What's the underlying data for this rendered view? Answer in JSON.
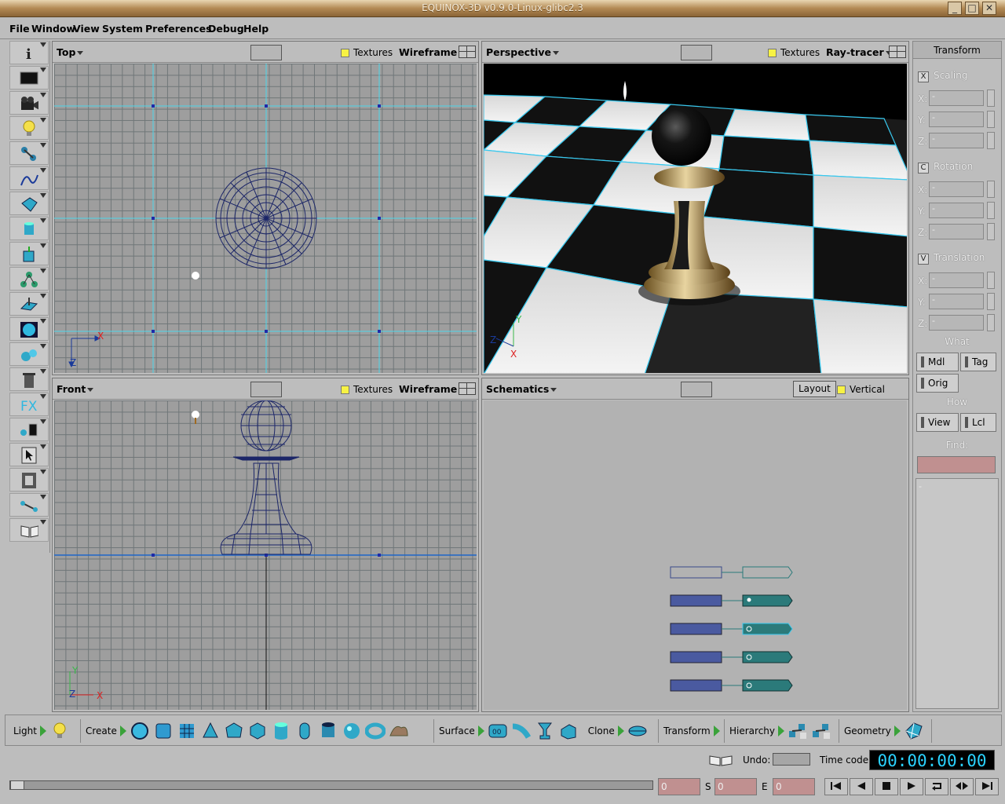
{
  "window": {
    "title": "EQUINOX-3D v0.9.0-Linux-glibc2.3"
  },
  "menus": [
    "File",
    "Window",
    "View",
    "System",
    "Preferences",
    "Debug",
    "Help"
  ],
  "left_tools": [
    "info",
    "monitor",
    "camera",
    "light",
    "nodes",
    "curve",
    "polygon",
    "cylinder-shape",
    "transform-box",
    "hierarchy",
    "plane-tool",
    "sphere",
    "molecule",
    "trash",
    "fx",
    "bone-pick",
    "cursor",
    "film",
    "link",
    "book"
  ],
  "viewports": {
    "top": {
      "name": "Top",
      "textures": "Textures",
      "mode": "Wireframe"
    },
    "perspective": {
      "name": "Perspective",
      "textures": "Textures",
      "mode": "Ray-tracer"
    },
    "front": {
      "name": "Front",
      "textures": "Textures",
      "mode": "Wireframe"
    },
    "schematics": {
      "name": "Schematics",
      "layout": "Layout",
      "vertical": "Vertical"
    }
  },
  "axes": {
    "x": "X",
    "y": "Y",
    "z": "Z"
  },
  "transform_panel": {
    "title": "Transform",
    "scaling": {
      "key": "X",
      "label": "Scaling"
    },
    "rotation": {
      "key": "C",
      "label": "Rotation"
    },
    "translation": {
      "key": "V",
      "label": "Translation"
    },
    "field_value": "-",
    "labels": {
      "x": "X:",
      "y": "Y:",
      "z": "Z:"
    },
    "what": "What",
    "what_buttons": [
      "Mdl",
      "Tag",
      "Orig"
    ],
    "how": "How",
    "how_buttons": [
      "View",
      "Lcl"
    ],
    "find": "Find:",
    "list_item": "-"
  },
  "shelf": {
    "light": "Light",
    "create": "Create",
    "surface": "Surface",
    "clone": "Clone",
    "transform": "Transform",
    "hierarchy": "Hierarchy",
    "geometry": "Geometry"
  },
  "bottom": {
    "undo_label": "Undo:",
    "timecode_label": "Time code",
    "timecode": "00:00:00:00",
    "current_frame": "0",
    "start_label": "S",
    "start_frame": "0",
    "end_label": "E",
    "end_frame": "0"
  },
  "colors": {
    "accent_cyan": "#2ad2ff",
    "wire_navy": "#1c2668",
    "field_pink": "#c09090",
    "node_teal": "#2b7a7a",
    "node_blue": "#4a5aa0"
  }
}
